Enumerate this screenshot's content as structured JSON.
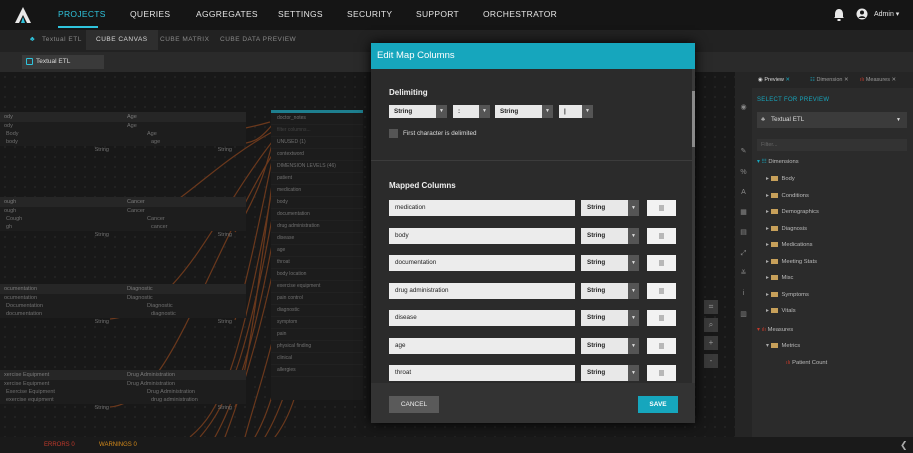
{
  "nav": {
    "items": [
      "PROJECTS",
      "QUERIES",
      "AGGREGATES",
      "SETTINGS",
      "SECURITY",
      "SUPPORT",
      "ORCHESTRATOR"
    ],
    "active": "PROJECTS",
    "user": "Admin ▾",
    "accent": "#2fc3dc"
  },
  "tabs": [
    "Textual ETL",
    "CUBE CANVAS",
    "CUBE MATRIX",
    "CUBE DATA PREVIEW"
  ],
  "subtab": "Textual ETL",
  "canvas": {
    "nodes_left": [
      {
        "title": "ody",
        "rows": [
          "ody",
          "Body",
          "body"
        ],
        "type": "String"
      },
      {
        "title": "ough",
        "rows": [
          "ough",
          "Cough",
          "gh"
        ],
        "type": "String"
      },
      {
        "title": "ocumentation",
        "rows": [
          "ocumentation",
          "Documentation",
          "documentation"
        ],
        "type": "String"
      },
      {
        "title": "xercise Equipment",
        "rows": [
          "xercise Equipment",
          "Exercise Equipment",
          "exercise equipment"
        ],
        "type": "String"
      }
    ],
    "nodes_mid": [
      {
        "title": "Age",
        "sub": "Age",
        "child": "Age",
        "childsub": "age",
        "type": "String"
      },
      {
        "title": "Cancer",
        "sub": "Cancer",
        "child": "Cancer",
        "childsub": "cancer",
        "type": "String"
      },
      {
        "title": "Diagnostic",
        "sub": "Diagnostic",
        "child": "Diagnostic",
        "childsub": "diagnostic",
        "type": "String"
      },
      {
        "title": "Drug Administration",
        "sub": "Drug Administration",
        "child": "Drug Administration",
        "childsub": "drug administration",
        "type": "String"
      }
    ],
    "table_title": "doctor_notes",
    "table_filter": "filter columns...",
    "unused_label": "UNUSED (1)",
    "unused": [
      "contextword"
    ],
    "levels_label": "DIMENSION LEVELS (46)",
    "levels": [
      "patient",
      "medication",
      "body",
      "documentation",
      "drug administration",
      "disease",
      "age",
      "throat",
      "body location",
      "exercise equipment",
      "pain control",
      "diagnostic",
      "symptom",
      "pain",
      "physical finding",
      "clinical",
      "allergies"
    ]
  },
  "modal": {
    "title": "Edit Map Columns",
    "delimiting_label": "Delimiting",
    "delims": [
      "String",
      ":",
      "String",
      "|"
    ],
    "checkbox_label": "First character is delimited",
    "mapped_label": "Mapped Columns",
    "columns": [
      {
        "name": "medication",
        "type": "String"
      },
      {
        "name": "body",
        "type": "String"
      },
      {
        "name": "documentation",
        "type": "String"
      },
      {
        "name": "drug administration",
        "type": "String"
      },
      {
        "name": "disease",
        "type": "String"
      },
      {
        "name": "age",
        "type": "String"
      },
      {
        "name": "throat",
        "type": "String"
      }
    ],
    "cancel": "CANCEL",
    "save": "SAVE"
  },
  "right": {
    "tabs": [
      "Preview",
      "Dimension",
      "Measures"
    ],
    "select_label": "SELECT FOR PREVIEW",
    "select_value": "Textual ETL",
    "filter": "Filter...",
    "tree_root": "Dimensions",
    "tree": [
      "Body",
      "Conditions",
      "Demographics",
      "Diagnosis",
      "Medications",
      "Meeting Stats",
      "Misc",
      "Symptoms",
      "Vitals"
    ],
    "measures_root": "Measures",
    "metrics": "Metrics",
    "patient_count": "Patient Count"
  },
  "status": {
    "errors": "ERRORS 0",
    "warnings": "WARNINGS 0"
  }
}
